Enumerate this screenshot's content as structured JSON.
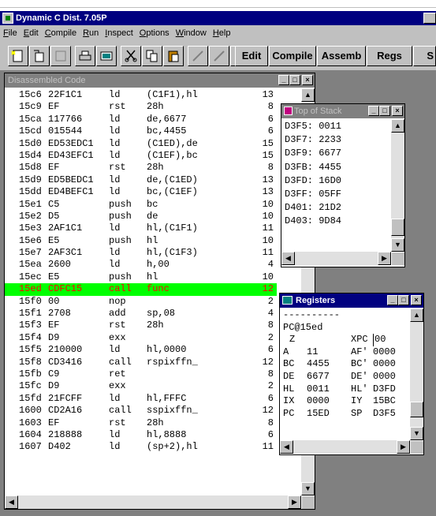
{
  "app": {
    "title": "Dynamic C Dist. 7.05P",
    "menu": [
      "File",
      "Edit",
      "Compile",
      "Run",
      "Inspect",
      "Options",
      "Window",
      "Help"
    ],
    "toolbar_text_buttons": [
      "Edit",
      "Compile",
      "Assemb",
      "Regs",
      "S"
    ]
  },
  "disassembly": {
    "title": "Disassembled Code",
    "rows": [
      {
        "addr": "15c6",
        "bytes": "22F1C1",
        "mnem": "ld",
        "ops": "(C1F1),hl",
        "cyc": "13"
      },
      {
        "addr": "15c9",
        "bytes": "EF",
        "mnem": "rst",
        "ops": "28h",
        "cyc": "8"
      },
      {
        "addr": "15ca",
        "bytes": "117766",
        "mnem": "ld",
        "ops": "de,6677",
        "cyc": "6"
      },
      {
        "addr": "15cd",
        "bytes": "015544",
        "mnem": "ld",
        "ops": "bc,4455",
        "cyc": "6"
      },
      {
        "addr": "15d0",
        "bytes": "ED53EDC1",
        "mnem": "ld",
        "ops": "(C1ED),de",
        "cyc": "15"
      },
      {
        "addr": "15d4",
        "bytes": "ED43EFC1",
        "mnem": "ld",
        "ops": "(C1EF),bc",
        "cyc": "15"
      },
      {
        "addr": "15d8",
        "bytes": "EF",
        "mnem": "rst",
        "ops": "28h",
        "cyc": "8"
      },
      {
        "addr": "15d9",
        "bytes": "ED5BEDC1",
        "mnem": "ld",
        "ops": "de,(C1ED)",
        "cyc": "13"
      },
      {
        "addr": "15dd",
        "bytes": "ED4BEFC1",
        "mnem": "ld",
        "ops": "bc,(C1EF)",
        "cyc": "13"
      },
      {
        "addr": "15e1",
        "bytes": "C5",
        "mnem": "push",
        "ops": "bc",
        "cyc": "10"
      },
      {
        "addr": "15e2",
        "bytes": "D5",
        "mnem": "push",
        "ops": "de",
        "cyc": "10"
      },
      {
        "addr": "15e3",
        "bytes": "2AF1C1",
        "mnem": "ld",
        "ops": "hl,(C1F1)",
        "cyc": "11"
      },
      {
        "addr": "15e6",
        "bytes": "E5",
        "mnem": "push",
        "ops": "hl",
        "cyc": "10"
      },
      {
        "addr": "15e7",
        "bytes": "2AF3C1",
        "mnem": "ld",
        "ops": "hl,(C1F3)",
        "cyc": "11"
      },
      {
        "addr": "15ea",
        "bytes": "2600",
        "mnem": "ld",
        "ops": "h,00",
        "cyc": "4"
      },
      {
        "addr": "15ec",
        "bytes": "E5",
        "mnem": "push",
        "ops": "hl",
        "cyc": "10"
      },
      {
        "addr": "15ed",
        "bytes": "CDFC15",
        "mnem": "call",
        "ops": "func",
        "cyc": "12"
      },
      {
        "addr": "15f0",
        "bytes": "00",
        "mnem": "nop",
        "ops": "",
        "cyc": "2"
      },
      {
        "addr": "15f1",
        "bytes": "2708",
        "mnem": "add",
        "ops": "sp,08",
        "cyc": "4"
      },
      {
        "addr": "15f3",
        "bytes": "EF",
        "mnem": "rst",
        "ops": "28h",
        "cyc": "8"
      },
      {
        "addr": "15f4",
        "bytes": "D9",
        "mnem": "exx",
        "ops": "",
        "cyc": "2"
      },
      {
        "addr": "15f5",
        "bytes": "210000",
        "mnem": "ld",
        "ops": "hl,0000",
        "cyc": "6"
      },
      {
        "addr": "15f8",
        "bytes": "CD3416",
        "mnem": "call",
        "ops": "rspixffn_",
        "cyc": "12"
      },
      {
        "addr": "15fb",
        "bytes": "C9",
        "mnem": "ret",
        "ops": "",
        "cyc": "8"
      },
      {
        "addr": "15fc",
        "bytes": "D9",
        "mnem": "exx",
        "ops": "",
        "cyc": "2"
      },
      {
        "addr": "15fd",
        "bytes": "21FCFF",
        "mnem": "ld",
        "ops": "hl,FFFC",
        "cyc": "6"
      },
      {
        "addr": "1600",
        "bytes": "CD2A16",
        "mnem": "call",
        "ops": "sspixffn_",
        "cyc": "12"
      },
      {
        "addr": "1603",
        "bytes": "EF",
        "mnem": "rst",
        "ops": "28h",
        "cyc": "8"
      },
      {
        "addr": "1604",
        "bytes": "218888",
        "mnem": "ld",
        "ops": "hl,8888",
        "cyc": "6"
      },
      {
        "addr": "1607",
        "bytes": "D402",
        "mnem": "ld",
        "ops": "(sp+2),hl",
        "cyc": "11"
      }
    ],
    "current_row": 16
  },
  "stack": {
    "title": "Top of Stack",
    "rows": [
      "D3F5: 0011",
      "D3F7: 2233",
      "D3F9: 6677",
      "D3FB: 4455",
      "D3FD: 16D0",
      "D3FF: 05FF",
      "D401: 21D2",
      "D403: 9D84"
    ]
  },
  "registers": {
    "title": "Registers",
    "separator": "----------",
    "pc_line": "PC@15ed",
    "flag_z": "Z",
    "xpc_label": "XPC",
    "xpc_value": "00",
    "rows": [
      {
        "r1": "A",
        "v1": "11",
        "r2": "AF'",
        "v2": "0000"
      },
      {
        "r1": "BC",
        "v1": "4455",
        "r2": "BC'",
        "v2": "0000"
      },
      {
        "r1": "DE",
        "v1": "6677",
        "r2": "DE'",
        "v2": "0000"
      },
      {
        "r1": "HL",
        "v1": "0011",
        "r2": "HL'",
        "v2": "D3FD"
      },
      {
        "r1": "IX",
        "v1": "0000",
        "r2": "IY",
        "v2": "15BC"
      },
      {
        "r1": "PC",
        "v1": "15ED",
        "r2": "SP",
        "v2": "D3F5"
      }
    ]
  },
  "colors": {
    "active_title": "#000080",
    "inactive_title": "#808080",
    "current_line_bg": "#00ff00",
    "current_line_fg": "#ff0000"
  }
}
